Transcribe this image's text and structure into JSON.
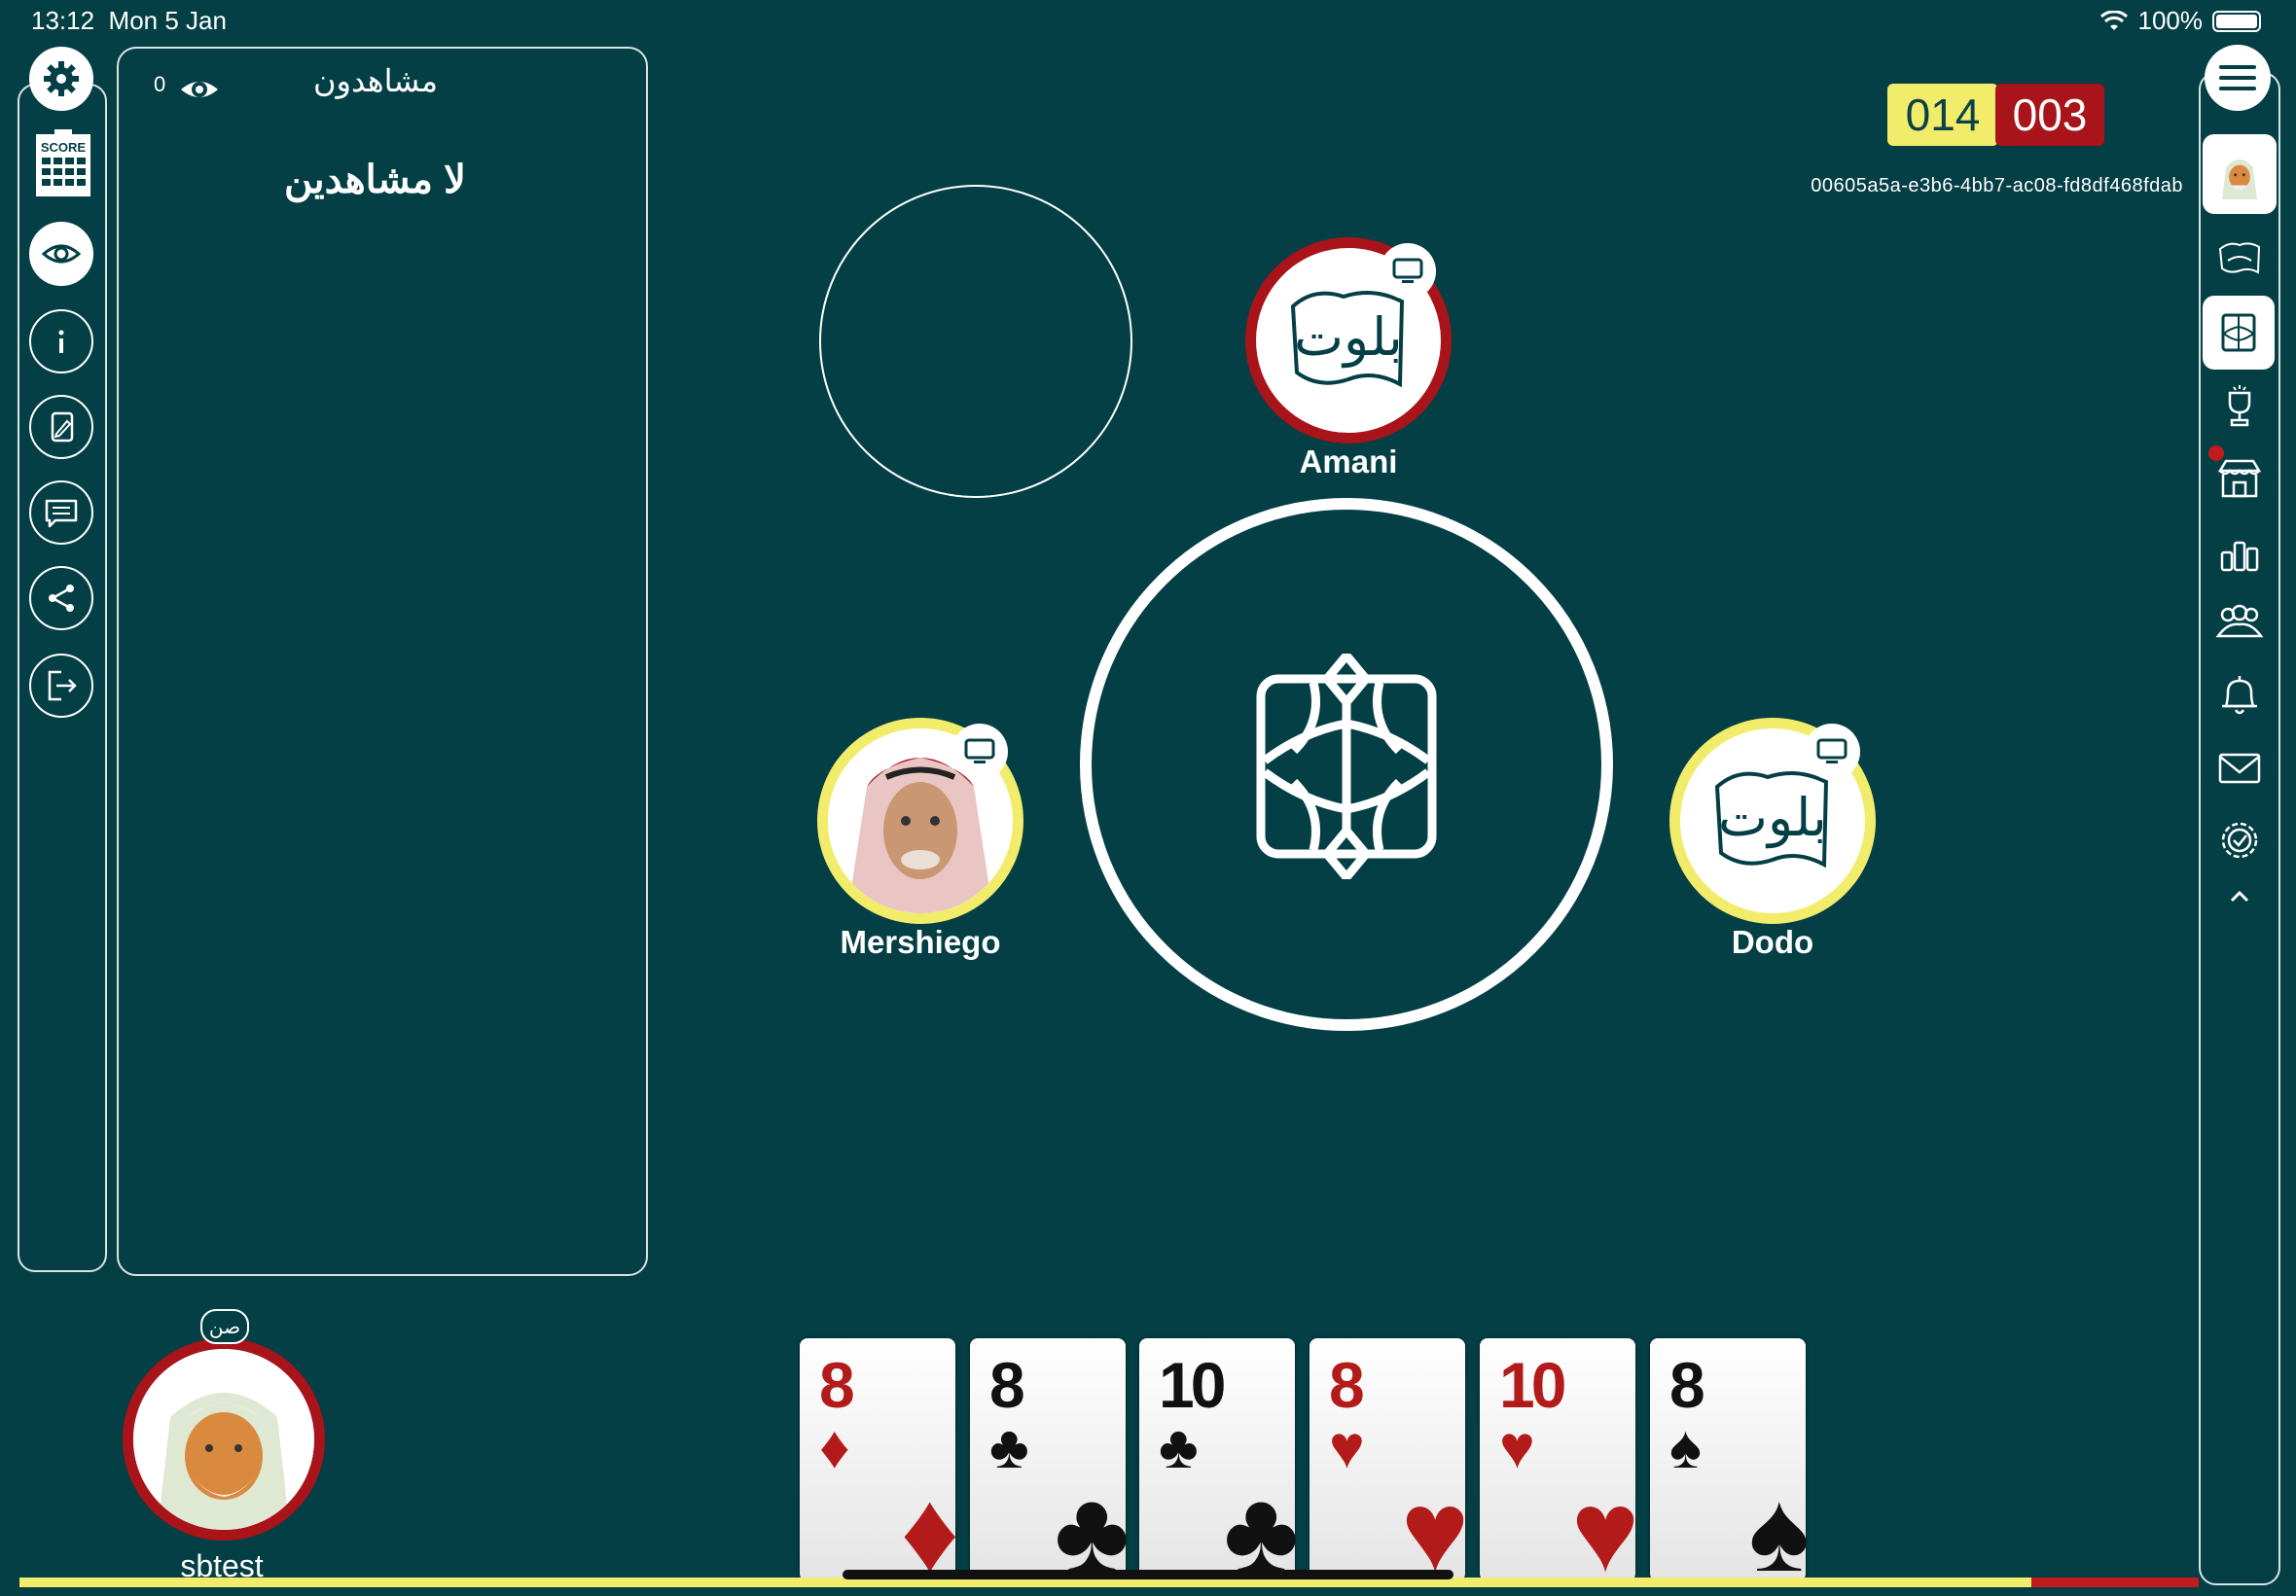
{
  "status_bar": {
    "time": "13:12",
    "date": "Mon 5 Jan",
    "battery": "100%"
  },
  "left_toolbar": {
    "items": [
      {
        "name": "settings",
        "icon": "gear-icon"
      },
      {
        "name": "score",
        "icon": "scoreboard-icon",
        "label": "SCORE"
      },
      {
        "name": "spectators",
        "icon": "eye-icon"
      },
      {
        "name": "info",
        "icon": "info-icon"
      },
      {
        "name": "cards",
        "icon": "card-edit-icon"
      },
      {
        "name": "chat",
        "icon": "chat-icon"
      },
      {
        "name": "share",
        "icon": "share-icon"
      },
      {
        "name": "exit",
        "icon": "exit-icon"
      }
    ]
  },
  "spectators": {
    "title": "مشاهدون",
    "count": "0",
    "empty_text": "لا مشاهدين"
  },
  "scores": {
    "team_yellow": "014",
    "team_red": "003"
  },
  "game_id": "00605a5a-e3b6-4bb7-ac08-fd8df468fdab",
  "players": {
    "top": {
      "name": "Amani",
      "avatar_label": "بلوت",
      "ring_color": "#a81419"
    },
    "left": {
      "name": "Mershiego",
      "ring_color": "#f2ec6b"
    },
    "right": {
      "name": "Dodo",
      "avatar_label": "بلوت",
      "ring_color": "#f2ec6b"
    },
    "me": {
      "name": "sbtest",
      "badge": "صن",
      "ring_color": "#a81419"
    }
  },
  "hand": [
    {
      "rank": "8",
      "suit": "♦",
      "color": "red"
    },
    {
      "rank": "8",
      "suit": "♣",
      "color": "black"
    },
    {
      "rank": "10",
      "suit": "♣",
      "color": "black"
    },
    {
      "rank": "8",
      "suit": "♥",
      "color": "red"
    },
    {
      "rank": "10",
      "suit": "♥",
      "color": "red"
    },
    {
      "rank": "8",
      "suit": "♠",
      "color": "black"
    }
  ],
  "right_nav": {
    "items": [
      "menu-icon",
      "profile-avatar",
      "baloot-logo-icon",
      "table-icon",
      "trophy-icon",
      "store-icon",
      "leaderboard-icon",
      "friends-icon",
      "bell-icon",
      "mail-icon",
      "badge-check-icon",
      "chevron-up-icon"
    ]
  },
  "colors": {
    "background": "#033f45",
    "team_yellow": "#f2ec6b",
    "team_red": "#a81419"
  }
}
